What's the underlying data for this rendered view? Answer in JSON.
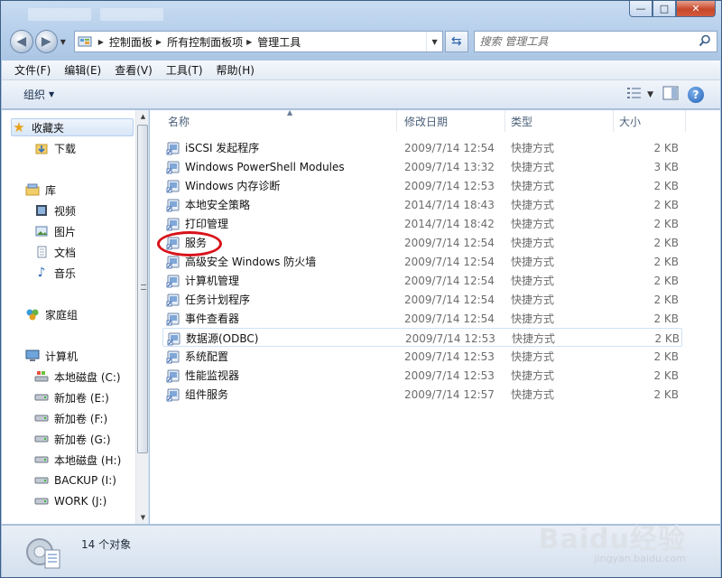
{
  "window": {
    "caption_minimize": "—",
    "caption_maximize": "□",
    "caption_close": "✕"
  },
  "address_bar": {
    "crumbs": [
      "控制面板",
      "所有控制面板项",
      "管理工具"
    ],
    "search_placeholder": "搜索 管理工具"
  },
  "menu": [
    "文件(F)",
    "编辑(E)",
    "查看(V)",
    "工具(T)",
    "帮助(H)"
  ],
  "toolbar": {
    "organize_label": "组织"
  },
  "nav_pane": {
    "favorites": "收藏夹",
    "downloads": "下载",
    "libraries": "库",
    "videos": "视频",
    "pictures": "图片",
    "documents": "文档",
    "music": "音乐",
    "homegroup": "家庭组",
    "computer": "计算机",
    "drives": [
      "本地磁盘 (C:)",
      "新加卷 (E:)",
      "新加卷 (F:)",
      "新加卷 (G:)",
      "本地磁盘 (H:)",
      "BACKUP (I:)",
      "WORK (J:)"
    ]
  },
  "columns": {
    "name": "名称",
    "date": "修改日期",
    "type": "类型",
    "size": "大小"
  },
  "files": [
    {
      "name": "iSCSI 发起程序",
      "date": "2009/7/14 12:54",
      "type": "快捷方式",
      "size": "2 KB"
    },
    {
      "name": "Windows PowerShell Modules",
      "date": "2009/7/14 13:32",
      "type": "快捷方式",
      "size": "3 KB"
    },
    {
      "name": "Windows 内存诊断",
      "date": "2009/7/14 12:53",
      "type": "快捷方式",
      "size": "2 KB"
    },
    {
      "name": "本地安全策略",
      "date": "2014/7/14 18:43",
      "type": "快捷方式",
      "size": "2 KB"
    },
    {
      "name": "打印管理",
      "date": "2014/7/14 18:42",
      "type": "快捷方式",
      "size": "2 KB"
    },
    {
      "name": "服务",
      "date": "2009/7/14 12:54",
      "type": "快捷方式",
      "size": "2 KB"
    },
    {
      "name": "高级安全 Windows 防火墙",
      "date": "2009/7/14 12:54",
      "type": "快捷方式",
      "size": "2 KB"
    },
    {
      "name": "计算机管理",
      "date": "2009/7/14 12:54",
      "type": "快捷方式",
      "size": "2 KB"
    },
    {
      "name": "任务计划程序",
      "date": "2009/7/14 12:54",
      "type": "快捷方式",
      "size": "2 KB"
    },
    {
      "name": "事件查看器",
      "date": "2009/7/14 12:54",
      "type": "快捷方式",
      "size": "2 KB"
    },
    {
      "name": "数据源(ODBC)",
      "date": "2009/7/14 12:53",
      "type": "快捷方式",
      "size": "2 KB"
    },
    {
      "name": "系统配置",
      "date": "2009/7/14 12:53",
      "type": "快捷方式",
      "size": "2 KB"
    },
    {
      "name": "性能监视器",
      "date": "2009/7/14 12:53",
      "type": "快捷方式",
      "size": "2 KB"
    },
    {
      "name": "组件服务",
      "date": "2009/7/14 12:57",
      "type": "快捷方式",
      "size": "2 KB"
    }
  ],
  "status": {
    "count_text": "14 个对象"
  },
  "watermark": {
    "brand": "Baidu经验",
    "url": "jingyan.baidu.com"
  },
  "colors": {
    "highlight_circle": "#d8121a",
    "accent": "#1f5fb6"
  }
}
